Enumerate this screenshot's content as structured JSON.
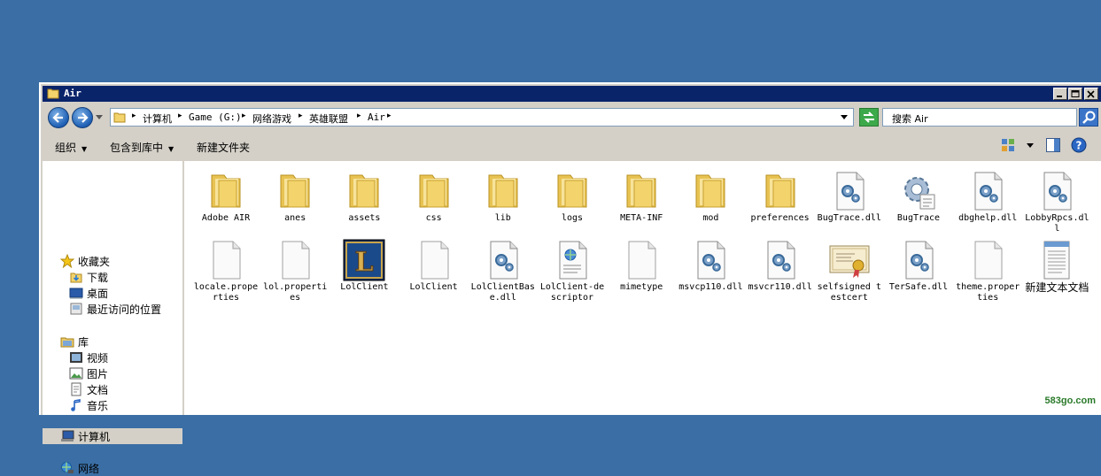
{
  "window": {
    "title": "Air"
  },
  "address": {
    "crumbs": [
      "计算机",
      "Game (G:)",
      "网络游戏",
      "英雄联盟",
      "Air"
    ],
    "search_placeholder": "搜索 Air"
  },
  "toolbar": {
    "organize": "组织",
    "include_in_library": "包含到库中",
    "new_folder": "新建文件夹"
  },
  "sidebar": {
    "favorites": "收藏夹",
    "downloads": "下载",
    "desktop": "桌面",
    "recent": "最近访问的位置",
    "library": "库",
    "videos": "视频",
    "pictures": "图片",
    "documents": "文档",
    "music": "音乐",
    "computer": "计算机",
    "network": "网络"
  },
  "files": [
    {
      "name": "Adobe AIR",
      "type": "folder"
    },
    {
      "name": "anes",
      "type": "folder"
    },
    {
      "name": "assets",
      "type": "folder"
    },
    {
      "name": "css",
      "type": "folder"
    },
    {
      "name": "lib",
      "type": "folder"
    },
    {
      "name": "logs",
      "type": "folder"
    },
    {
      "name": "META-INF",
      "type": "folder"
    },
    {
      "name": "mod",
      "type": "folder"
    },
    {
      "name": "preferences",
      "type": "folder"
    },
    {
      "name": "BugTrace.dll",
      "type": "dll"
    },
    {
      "name": "BugTrace",
      "type": "exe"
    },
    {
      "name": "dbghelp.dll",
      "type": "dll"
    },
    {
      "name": "LobbyRpcs.dll",
      "type": "dll"
    },
    {
      "name": "locale.properties",
      "type": "blank"
    },
    {
      "name": "lol.properties",
      "type": "blank"
    },
    {
      "name": "LolClient",
      "type": "lol"
    },
    {
      "name": "LolClient",
      "type": "blank"
    },
    {
      "name": "LolClientBase.dll",
      "type": "dll"
    },
    {
      "name": "LolClient-descriptor",
      "type": "xml"
    },
    {
      "name": "mimetype",
      "type": "blank"
    },
    {
      "name": "msvcp110.dll",
      "type": "dll"
    },
    {
      "name": "msvcr110.dll",
      "type": "dll"
    },
    {
      "name": "selfsigned testcert",
      "type": "cert"
    },
    {
      "name": "TerSafe.dll",
      "type": "dll"
    },
    {
      "name": "theme.properties",
      "type": "blank"
    },
    {
      "name": "新建文本文档",
      "type": "txt"
    }
  ],
  "watermark": "583go.com"
}
